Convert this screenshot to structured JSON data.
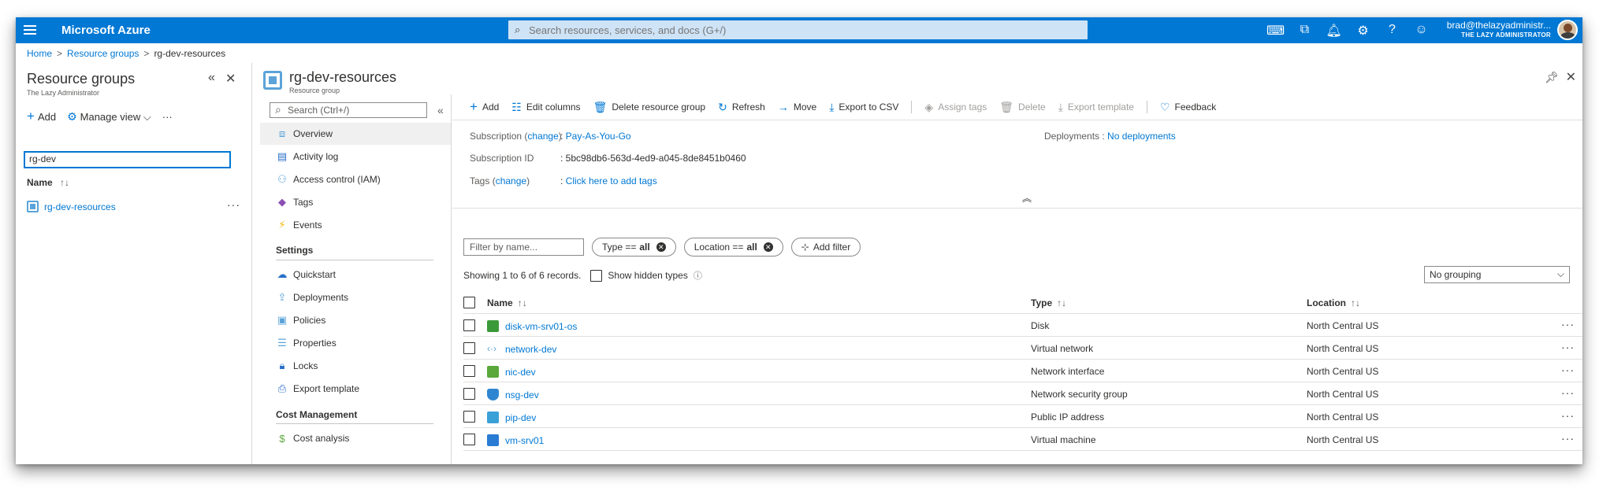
{
  "topbar": {
    "brand": "Microsoft Azure",
    "search_placeholder": "Search resources, services, and docs (G+/)",
    "icons": [
      "cloud-shell-icon",
      "directory-filter-icon",
      "bell-icon",
      "gear-icon",
      "help-icon",
      "feedback-smiley-icon"
    ],
    "user_email": "brad@thelazyadministr...",
    "user_tenant": "THE LAZY ADMINISTRATOR"
  },
  "breadcrumb": {
    "home": "Home",
    "resource_groups": "Resource groups",
    "current": "rg-dev-resources"
  },
  "left_blade": {
    "title": "Resource groups",
    "subtitle": "The Lazy Administrator",
    "add_label": "Add",
    "manage_view_label": "Manage view",
    "filter_value": "rg-dev",
    "name_header": "Name",
    "items": [
      {
        "name": "rg-dev-resources"
      }
    ]
  },
  "main": {
    "title": "rg-dev-resources",
    "subtitle": "Resource group"
  },
  "menu": {
    "search_placeholder": "Search (Ctrl+/)",
    "items": [
      {
        "label": "Overview",
        "icon": "overview-icon"
      },
      {
        "label": "Activity log",
        "icon": "activity-log-icon"
      },
      {
        "label": "Access control (IAM)",
        "icon": "iam-icon"
      },
      {
        "label": "Tags",
        "icon": "tags-icon"
      },
      {
        "label": "Events",
        "icon": "events-icon"
      }
    ],
    "settings_header": "Settings",
    "settings_items": [
      {
        "label": "Quickstart",
        "icon": "quickstart-icon"
      },
      {
        "label": "Deployments",
        "icon": "deployments-icon"
      },
      {
        "label": "Policies",
        "icon": "policies-icon"
      },
      {
        "label": "Properties",
        "icon": "properties-icon"
      },
      {
        "label": "Locks",
        "icon": "lock-icon"
      },
      {
        "label": "Export template",
        "icon": "export-template-icon"
      }
    ],
    "cost_header": "Cost Management",
    "cost_items": [
      {
        "label": "Cost analysis",
        "icon": "cost-analysis-icon"
      }
    ]
  },
  "commands": {
    "add": "Add",
    "edit_columns": "Edit columns",
    "delete_rg": "Delete resource group",
    "refresh": "Refresh",
    "move": "Move",
    "export_csv": "Export to CSV",
    "assign_tags": "Assign tags",
    "delete": "Delete",
    "export_template": "Export template",
    "feedback": "Feedback"
  },
  "essentials": {
    "subscription_label": "Subscription",
    "change": "change",
    "subscription_value": "Pay-As-You-Go",
    "subscription_id_label": "Subscription ID",
    "subscription_id_value": "5bc98db6-563d-4ed9-a045-8de8451b0460",
    "tags_label": "Tags",
    "tags_value": "Click here to add tags",
    "deployments_label": "Deployments",
    "deployments_value": "No deployments"
  },
  "filters": {
    "name_placeholder": "Filter by name...",
    "type_label": "Type ==",
    "type_value": "all",
    "location_label": "Location ==",
    "location_value": "all",
    "add_filter": "Add filter"
  },
  "records": {
    "showing": "Showing 1 to 6 of 6 records.",
    "show_hidden": "Show hidden types",
    "grouping": "No grouping"
  },
  "table": {
    "headers": {
      "name": "Name",
      "type": "Type",
      "location": "Location"
    },
    "rows": [
      {
        "name": "disk-vm-srv01-os",
        "type": "Disk",
        "location": "North Central US",
        "icon": "disk-icon",
        "color": "#3a9a3a"
      },
      {
        "name": "network-dev",
        "type": "Virtual network",
        "location": "North Central US",
        "icon": "vnet-icon",
        "color": "#5ba3d9"
      },
      {
        "name": "nic-dev",
        "type": "Network interface",
        "location": "North Central US",
        "icon": "nic-icon",
        "color": "#5aa83c"
      },
      {
        "name": "nsg-dev",
        "type": "Network security group",
        "location": "North Central US",
        "icon": "shield-icon",
        "color": "#2f86d0"
      },
      {
        "name": "pip-dev",
        "type": "Public IP address",
        "location": "North Central US",
        "icon": "public-ip-icon",
        "color": "#3aa0d8"
      },
      {
        "name": "vm-srv01",
        "type": "Virtual machine",
        "location": "North Central US",
        "icon": "vm-icon",
        "color": "#2a7bd3"
      }
    ]
  },
  "colors": {
    "accent": "#0078d4",
    "topbar": "#0078d4"
  }
}
